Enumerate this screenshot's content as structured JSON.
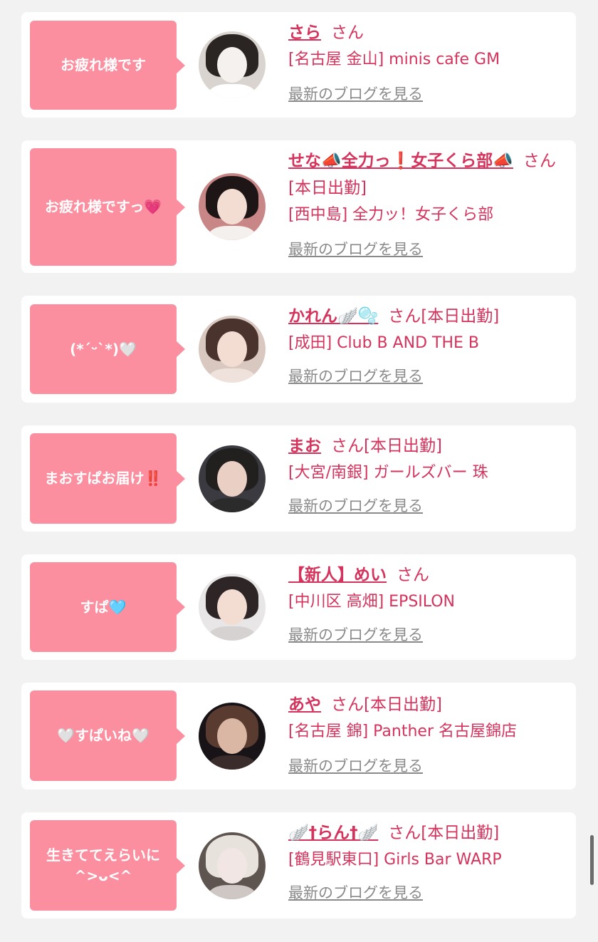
{
  "posts": [
    {
      "message": "お疲れ様です",
      "name": "さら",
      "suffix": "さん",
      "shop": "[名古屋 金山] minis cafe GM",
      "blog_link": "最新のブログを見る",
      "avatar": "woman-with-cat-mask"
    },
    {
      "message": "お疲れ様ですっ💗",
      "name": "せな📣全力っ❗️女子くら部📣",
      "suffix": "さん[本日出勤]",
      "shop": "[西中島] 全力ッ！女子くら部",
      "blog_link": "最新のブログを見る",
      "avatar": "woman-with-black-bow"
    },
    {
      "message": "(*ˊᵕˋ*)🤍",
      "name": "かれん🪽🫧",
      "suffix": "さん[本日出勤]",
      "shop": "[成田] Club B AND THE B",
      "blog_link": "最新のブログを見る",
      "avatar": "woman-posing"
    },
    {
      "message": "まおすぱお届け‼️",
      "name": "まお",
      "suffix": "さん[本日出勤]",
      "shop": "[大宮/南銀] ガールズバー 珠",
      "blog_link": "最新のブログを見る",
      "avatar": "woman-with-cat-ears"
    },
    {
      "message": "すぱ🩵",
      "name": "【新人】めい",
      "suffix": "さん",
      "shop": "[中川区 高畑] EPSILON",
      "blog_link": "最新のブログを見る",
      "avatar": "woman-with-bunny-ears"
    },
    {
      "message": "🤍すぱいね🤍",
      "name": "あや",
      "suffix": "さん[本日出勤]",
      "shop": "[名古屋 錦] Panther 名古屋錦店",
      "blog_link": "最新のブログを見る",
      "avatar": "panther-shop-logo"
    },
    {
      "message": "生きててえらいに ^>ᴗ<^",
      "name": "🪽†らん†🪽",
      "suffix": "さん[本日出勤]",
      "shop": "[鶴見駅東口] Girls Bar WARP",
      "blog_link": "最新のブログを見る",
      "avatar": "woman-blonde-closeup"
    }
  ],
  "colors": {
    "accent": "#d5335c",
    "bubble": "#fb8f9f",
    "background": "#f2f2f2",
    "link_gray": "#8a8a8a"
  }
}
